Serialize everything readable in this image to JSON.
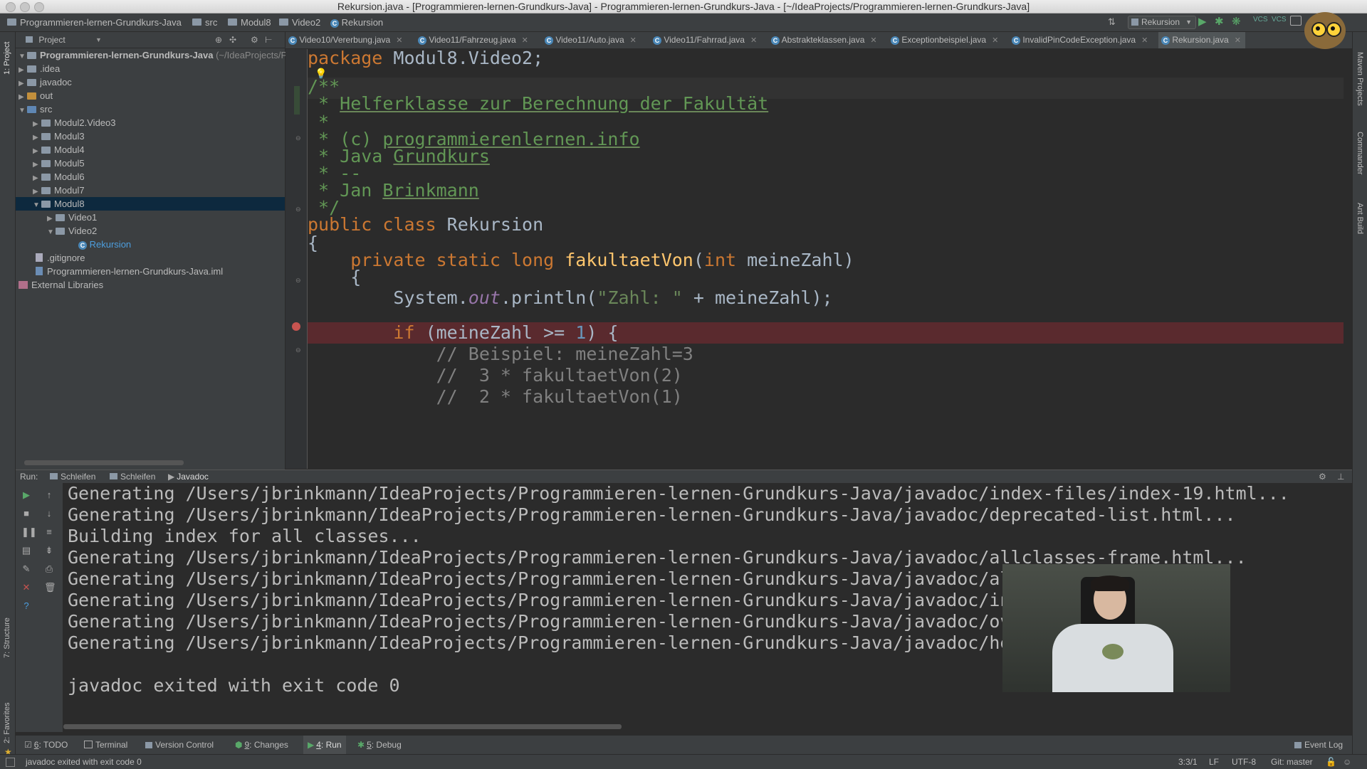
{
  "window": {
    "title": "Rekursion.java - [Programmieren-lernen-Grundkurs-Java] - Programmieren-lernen-Grundkurs-Java - [~/IdeaProjects/Programmieren-lernen-Grundkurs-Java]"
  },
  "breadcrumbs": [
    "Programmieren-lernen-Grundkurs-Java",
    "src",
    "Modul8",
    "Video2",
    "Rekursion"
  ],
  "run_config": "Rekursion",
  "left_tool_windows": [
    "1: Project",
    "7: Structure",
    "2: Favorites"
  ],
  "right_tool_windows": [
    "Maven Projects",
    "Commander",
    "Ant Build"
  ],
  "project_panel": {
    "header": "Project",
    "tree": [
      {
        "label": "Programmieren-lernen-Grundkurs-Java",
        "suffix": "(~/IdeaProjects/P",
        "bold": true
      },
      {
        "label": ".idea"
      },
      {
        "label": "javadoc"
      },
      {
        "label": "out"
      },
      {
        "label": "src"
      },
      {
        "label": "Modul2.Video3"
      },
      {
        "label": "Modul3"
      },
      {
        "label": "Modul4"
      },
      {
        "label": "Modul5"
      },
      {
        "label": "Modul6"
      },
      {
        "label": "Modul7"
      },
      {
        "label": "Modul8"
      },
      {
        "label": "Video1"
      },
      {
        "label": "Video2"
      },
      {
        "label": "Rekursion"
      },
      {
        "label": ".gitignore"
      },
      {
        "label": "Programmieren-lernen-Grundkurs-Java.iml"
      },
      {
        "label": "External Libraries"
      }
    ]
  },
  "editor_tabs": [
    "Video10/Vererbung.java",
    "Video11/Fahrzeug.java",
    "Video11/Auto.java",
    "Video11/Fahrrad.java",
    "Abstrakteklassen.java",
    "Exceptionbeispiel.java",
    "InvalidPinCodeException.java",
    "Rekursion.java"
  ],
  "code": {
    "l1_kw": "package",
    "l1_rest": " Modul8.Video2;",
    "l3": "/**",
    "l4_star": " * ",
    "l4_txt": "Helferklasse zur Berechnung der Fakultät",
    "l5": " *",
    "l6_a": " * (c) ",
    "l6_b": "programmierenlernen.info",
    "l7_a": " * Java ",
    "l7_b": "Grundkurs",
    "l8": " * --",
    "l9_a": " * Jan ",
    "l9_b": "Brinkmann",
    "l10": " */",
    "l11_kw": "public class",
    "l11_rest": " Rekursion",
    "l12": "{",
    "l13_kw": "    private static long ",
    "l13_fn": "fakultaetVon",
    "l13_p1": "(",
    "l13_kw2": "int",
    "l13_rest": " meineZahl)",
    "l14": "    {",
    "l15_a": "        System.",
    "l15_fd": "out",
    "l15_b": ".println(",
    "l15_st": "\"Zahl: \"",
    "l15_c": " + meineZahl);",
    "l17_kw": "        if",
    "l17_a": " (meineZahl >= ",
    "l17_nm": "1",
    "l17_b": ") {",
    "l18": "            // Beispiel: meineZahl=3",
    "l19": "            //  3 * fakultaetVon(2)",
    "l20": "            //  2 * fakultaetVon(1)"
  },
  "run_panel": {
    "label": "Run:",
    "tabs": [
      "Schleifen",
      "Schleifen",
      "Javadoc"
    ],
    "output": [
      "Generating /Users/jbrinkmann/IdeaProjects/Programmieren-lernen-Grundkurs-Java/javadoc/index-files/index-19.html...",
      "Generating /Users/jbrinkmann/IdeaProjects/Programmieren-lernen-Grundkurs-Java/javadoc/deprecated-list.html...",
      "Building index for all classes...",
      "Generating /Users/jbrinkmann/IdeaProjects/Programmieren-lernen-Grundkurs-Java/javadoc/allclasses-frame.html...",
      "Generating /Users/jbrinkmann/IdeaProjects/Programmieren-lernen-Grundkurs-Java/javadoc/al",
      "Generating /Users/jbrinkmann/IdeaProjects/Programmieren-lernen-Grundkurs-Java/javadoc/in",
      "Generating /Users/jbrinkmann/IdeaProjects/Programmieren-lernen-Grundkurs-Java/javadoc/ov",
      "Generating /Users/jbrinkmann/IdeaProjects/Programmieren-lernen-Grundkurs-Java/javadoc/he",
      "javadoc exited with exit code 0"
    ]
  },
  "tool_tabs": [
    {
      "num": "6",
      "label": ": TODO"
    },
    {
      "num": "",
      "label": "Terminal"
    },
    {
      "num": "",
      "label": "Version Control"
    },
    {
      "num": "9",
      "label": ": Changes"
    },
    {
      "num": "4",
      "label": ": Run"
    },
    {
      "num": "5",
      "label": ": Debug"
    }
  ],
  "event_log": "Event Log",
  "status": {
    "message": "javadoc exited with exit code 0",
    "position": "3:3/1",
    "line_sep": "LF",
    "encoding": "UTF-8",
    "vcs": "Git: master"
  },
  "colors": {
    "background": "#2b2b2b",
    "keyword": "#cc7832",
    "doc_comment": "#629755",
    "function": "#ffc66d",
    "string": "#6a8759",
    "breakpoint_line": "#5a2a2e",
    "selection": "#0d293e"
  }
}
